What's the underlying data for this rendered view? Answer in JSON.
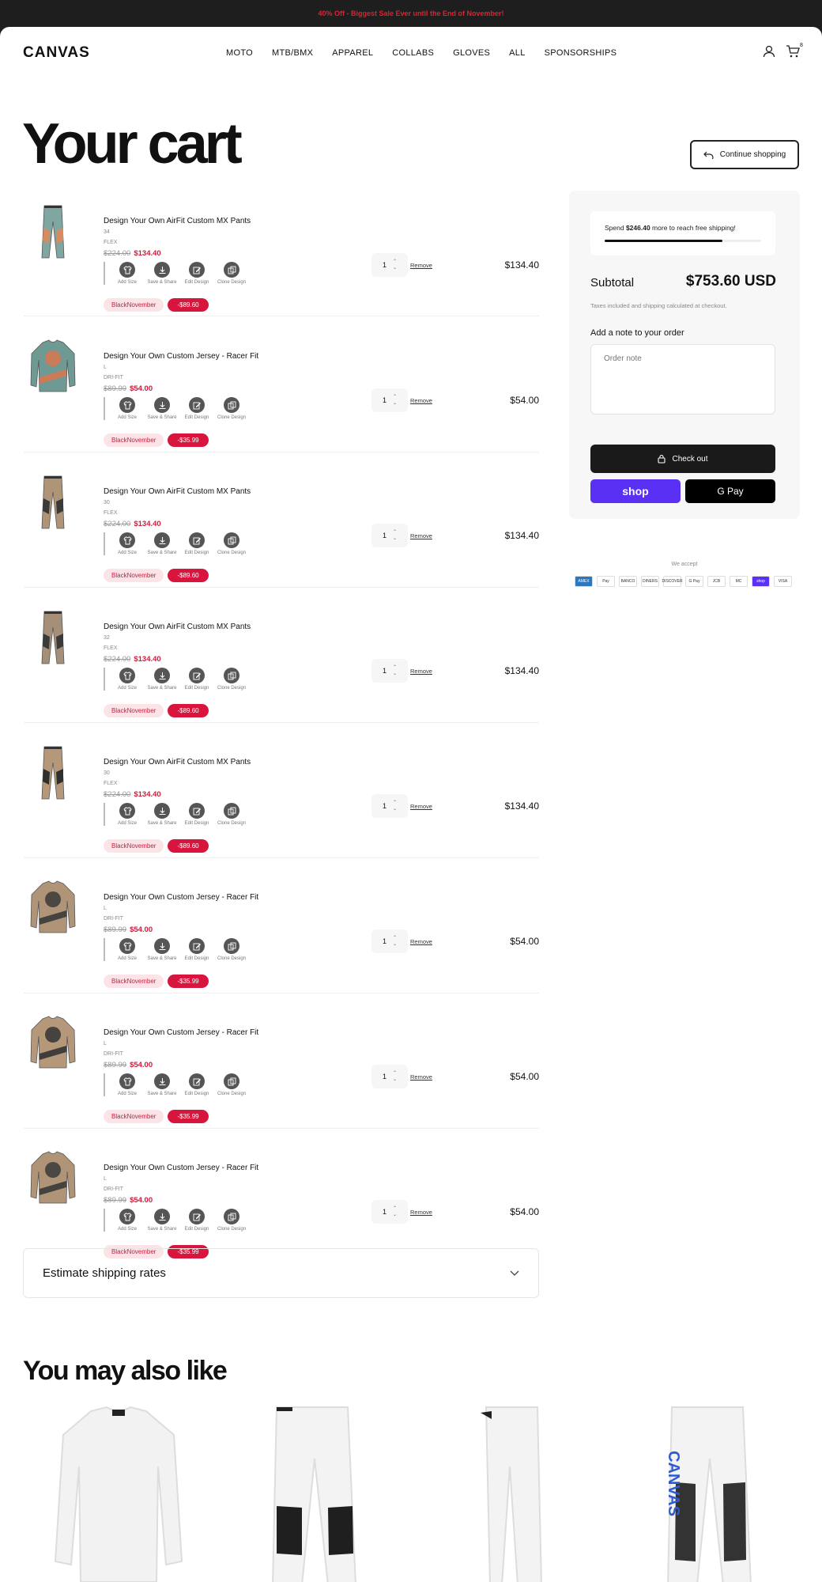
{
  "announcement": "40% Off - Biggest Sale Ever until the End of November!",
  "header": {
    "logo": "CANVAS",
    "nav": [
      "MOTO",
      "MTB/BMX",
      "APPAREL",
      "COLLABS",
      "GLOVES",
      "ALL",
      "SPONSORSHIPS"
    ],
    "cart_count": "8"
  },
  "page_title": "Your cart",
  "continue_label": "Continue shopping",
  "actions": [
    "Add Size",
    "Save & Share",
    "Edit Design",
    "Clone Design"
  ],
  "remove_label": "Remove",
  "items": [
    {
      "name": "Design Your Own AirFit Custom MX Pants",
      "size": "34",
      "fabric": "FLEX",
      "old_price": "$224.00",
      "price": "$134.40",
      "tag": "BlackNovember",
      "discount": "-$89.60",
      "qty": "1",
      "total": "$134.40",
      "kind": "pants",
      "colors": [
        "#7fa6a0",
        "#d98a5e"
      ]
    },
    {
      "name": "Design Your Own Custom Jersey - Racer Fit",
      "size": "L",
      "fabric": "DRI-FIT",
      "old_price": "$89.99",
      "price": "$54.00",
      "tag": "BlackNovember",
      "discount": "-$35.99",
      "qty": "1",
      "total": "$54.00",
      "kind": "jersey",
      "colors": [
        "#6f9a94",
        "#d9774e"
      ]
    },
    {
      "name": "Design Your Own AirFit Custom MX Pants",
      "size": "30",
      "fabric": "FLEX",
      "old_price": "$224.00",
      "price": "$134.40",
      "tag": "BlackNovember",
      "discount": "-$89.60",
      "qty": "1",
      "total": "$134.40",
      "kind": "pants",
      "colors": [
        "#b09478",
        "#3a3a3a"
      ]
    },
    {
      "name": "Design Your Own AirFit Custom MX Pants",
      "size": "32",
      "fabric": "FLEX",
      "old_price": "$224.00",
      "price": "$134.40",
      "tag": "BlackNovember",
      "discount": "-$89.60",
      "qty": "1",
      "total": "$134.40",
      "kind": "pants",
      "colors": [
        "#a58f78",
        "#3a3a3a"
      ]
    },
    {
      "name": "Design Your Own AirFit Custom MX Pants",
      "size": "30",
      "fabric": "FLEX",
      "old_price": "$224.00",
      "price": "$134.40",
      "tag": "BlackNovember",
      "discount": "-$89.60",
      "qty": "1",
      "total": "$134.40",
      "kind": "pants",
      "colors": [
        "#b5987a",
        "#2f2f2f"
      ]
    },
    {
      "name": "Design Your Own Custom Jersey - Racer Fit",
      "size": "L",
      "fabric": "DRI-FIT",
      "old_price": "$89.99",
      "price": "$54.00",
      "tag": "BlackNovember",
      "discount": "-$35.99",
      "qty": "1",
      "total": "$54.00",
      "kind": "jersey",
      "colors": [
        "#b09478",
        "#3a3a3a"
      ]
    },
    {
      "name": "Design Your Own Custom Jersey - Racer Fit",
      "size": "L",
      "fabric": "DRI-FIT",
      "old_price": "$89.99",
      "price": "$54.00",
      "tag": "BlackNovember",
      "discount": "-$35.99",
      "qty": "1",
      "total": "$54.00",
      "kind": "jersey",
      "colors": [
        "#b5987a",
        "#333333"
      ]
    },
    {
      "name": "Design Your Own Custom Jersey - Racer Fit",
      "size": "L",
      "fabric": "DRI-FIT",
      "old_price": "$89.99",
      "price": "$54.00",
      "tag": "BlackNovember",
      "discount": "-$35.99",
      "qty": "1",
      "total": "$54.00",
      "kind": "jersey",
      "colors": [
        "#b09478",
        "#3a3a3a"
      ]
    }
  ],
  "estimate_shipping": "Estimate shipping rates",
  "summary": {
    "ship_pre": "Spend ",
    "ship_amount": "$246.40",
    "ship_post": " more to reach free shipping!",
    "ship_progress": 0.75,
    "subtotal_label": "Subtotal",
    "subtotal_value": "$753.60 USD",
    "taxes": "Taxes included and shipping calculated at checkout.",
    "note_label": "Add a note to your order",
    "note_placeholder": "Order note",
    "checkout": "Check out",
    "shop_pay": "shop",
    "gpay": "G Pay"
  },
  "we_accept": "We accept",
  "payment_cards": [
    "AMEX",
    "Pay",
    "BANCO",
    "DINERS",
    "DISCOVER",
    "G Pay",
    "JCB",
    "MC",
    "shop",
    "VISA"
  ],
  "also_like": "You may also like"
}
